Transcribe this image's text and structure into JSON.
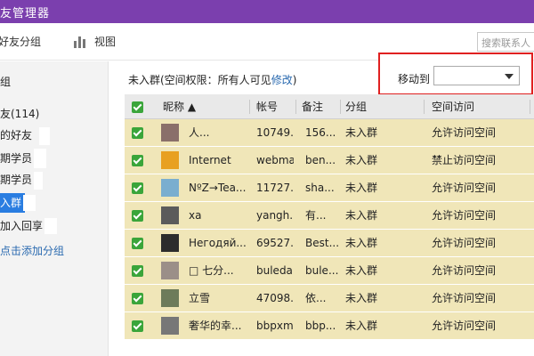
{
  "window": {
    "title": "友管理器"
  },
  "toolbar": {
    "group_label": "好友分组",
    "view_label": "视图",
    "search_placeholder": "搜索联系人"
  },
  "sidebar": {
    "header": "组",
    "items": [
      {
        "label": "友(114)"
      },
      {
        "label": "的好友"
      },
      {
        "label": "期学员"
      },
      {
        "label": "期学员"
      },
      {
        "label": "入群"
      },
      {
        "label": "加入回享"
      }
    ],
    "add_label": "点击添加分组"
  },
  "main": {
    "permission_prefix": "未入群(空间权限：所有人可见",
    "permission_link": "修改",
    "permission_suffix": ")",
    "move_to_label": "移动到",
    "move_to_value": ""
  },
  "table": {
    "headers": {
      "nickname": "昵称 ▲",
      "account": "帐号",
      "remark": "备注",
      "group": "分组",
      "space": "空间访问"
    },
    "rows": [
      {
        "nickname": "人...",
        "account": "10749...",
        "remark": "156...",
        "group": "未入群",
        "space": "允许访问空间",
        "avatar": "#8a6f6a"
      },
      {
        "nickname": "Internet",
        "account": "webma...",
        "remark": "ben...",
        "group": "未入群",
        "space": "禁止访问空间",
        "avatar": "#e8a020"
      },
      {
        "nickname": "NºZ→Tea...",
        "account": "11727...",
        "remark": "sha...",
        "group": "未入群",
        "space": "允许访问空间",
        "avatar": "#7aaecf"
      },
      {
        "nickname": "xa",
        "account": "yangh...",
        "remark": "有...",
        "group": "未入群",
        "space": "允许访问空间",
        "avatar": "#5b5b5b"
      },
      {
        "nickname": "Негодяй...",
        "account": "69527...",
        "remark": "Best...",
        "group": "未入群",
        "space": "允许访问空间",
        "avatar": "#2c2c2c"
      },
      {
        "nickname": "□  七分...",
        "account": "buleda...",
        "remark": "bule...",
        "group": "未入群",
        "space": "允许访问空间",
        "avatar": "#9b8f88"
      },
      {
        "nickname": "立雪",
        "account": "47098...",
        "remark": "依...",
        "group": "未入群",
        "space": "允许访问空间",
        "avatar": "#6d7b5a"
      },
      {
        "nickname": "奢华的幸...",
        "account": "bbpxm...",
        "remark": "bbp...",
        "group": "未入群",
        "space": "允许访问空间",
        "avatar": "#777777"
      }
    ]
  }
}
